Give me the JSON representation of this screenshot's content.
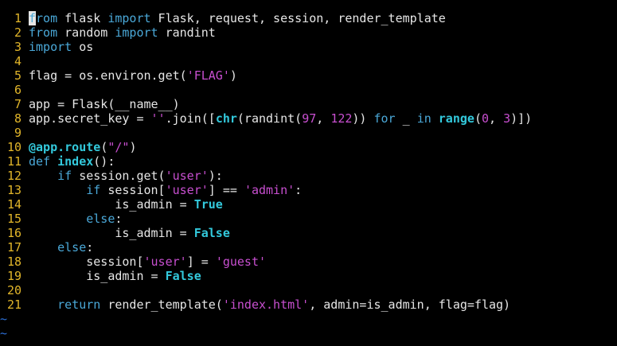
{
  "colors": {
    "background": "#000000",
    "text": "#e6e6e6",
    "line_number": "#e2b62a",
    "keyword": "#4aa8d8",
    "string": "#c84fd0",
    "builtin": "#33c9dc",
    "tilde": "#2c6fd6"
  },
  "editor": {
    "cursor_line": 1,
    "lines": [
      {
        "num": "1",
        "tokens": [
          {
            "t": "f",
            "k": "cursor"
          },
          {
            "t": "rom",
            "k": "keyword"
          },
          {
            "t": " flask ",
            "k": "plain"
          },
          {
            "t": "import",
            "k": "keyword"
          },
          {
            "t": " Flask, request, session, render_template",
            "k": "plain"
          }
        ]
      },
      {
        "num": "2",
        "tokens": [
          {
            "t": "from",
            "k": "keyword"
          },
          {
            "t": " random ",
            "k": "plain"
          },
          {
            "t": "import",
            "k": "keyword"
          },
          {
            "t": " randint",
            "k": "plain"
          }
        ]
      },
      {
        "num": "3",
        "tokens": [
          {
            "t": "import",
            "k": "keyword"
          },
          {
            "t": " os",
            "k": "plain"
          }
        ]
      },
      {
        "num": "4",
        "tokens": []
      },
      {
        "num": "5",
        "tokens": [
          {
            "t": "flag = os.environ.get(",
            "k": "plain"
          },
          {
            "t": "'FLAG'",
            "k": "string"
          },
          {
            "t": ")",
            "k": "plain"
          }
        ]
      },
      {
        "num": "6",
        "tokens": []
      },
      {
        "num": "7",
        "tokens": [
          {
            "t": "app = Flask(__name__)",
            "k": "plain"
          }
        ]
      },
      {
        "num": "8",
        "tokens": [
          {
            "t": "app.secret_key = ",
            "k": "plain"
          },
          {
            "t": "''",
            "k": "string"
          },
          {
            "t": ".join([",
            "k": "plain"
          },
          {
            "t": "chr",
            "k": "builtin"
          },
          {
            "t": "(randint(",
            "k": "plain"
          },
          {
            "t": "97",
            "k": "number"
          },
          {
            "t": ", ",
            "k": "plain"
          },
          {
            "t": "122",
            "k": "number"
          },
          {
            "t": ")) ",
            "k": "plain"
          },
          {
            "t": "for",
            "k": "keyword"
          },
          {
            "t": " _ ",
            "k": "plain"
          },
          {
            "t": "in",
            "k": "keyword"
          },
          {
            "t": " ",
            "k": "plain"
          },
          {
            "t": "range",
            "k": "builtin"
          },
          {
            "t": "(",
            "k": "plain"
          },
          {
            "t": "0",
            "k": "number"
          },
          {
            "t": ", ",
            "k": "plain"
          },
          {
            "t": "3",
            "k": "number"
          },
          {
            "t": ")])",
            "k": "plain"
          }
        ]
      },
      {
        "num": "9",
        "tokens": []
      },
      {
        "num": "10",
        "tokens": [
          {
            "t": "@app.route",
            "k": "decorator"
          },
          {
            "t": "(",
            "k": "plain"
          },
          {
            "t": "\"/\"",
            "k": "string"
          },
          {
            "t": ")",
            "k": "plain"
          }
        ]
      },
      {
        "num": "11",
        "tokens": [
          {
            "t": "def",
            "k": "keyword"
          },
          {
            "t": " ",
            "k": "plain"
          },
          {
            "t": "index",
            "k": "funcname"
          },
          {
            "t": "():",
            "k": "plain"
          }
        ]
      },
      {
        "num": "12",
        "tokens": [
          {
            "t": "    ",
            "k": "plain"
          },
          {
            "t": "if",
            "k": "keyword"
          },
          {
            "t": " session.get(",
            "k": "plain"
          },
          {
            "t": "'user'",
            "k": "string"
          },
          {
            "t": "):",
            "k": "plain"
          }
        ]
      },
      {
        "num": "13",
        "tokens": [
          {
            "t": "        ",
            "k": "plain"
          },
          {
            "t": "if",
            "k": "keyword"
          },
          {
            "t": " session[",
            "k": "plain"
          },
          {
            "t": "'user'",
            "k": "string"
          },
          {
            "t": "] == ",
            "k": "plain"
          },
          {
            "t": "'admin'",
            "k": "string"
          },
          {
            "t": ":",
            "k": "plain"
          }
        ]
      },
      {
        "num": "14",
        "tokens": [
          {
            "t": "            is_admin = ",
            "k": "plain"
          },
          {
            "t": "True",
            "k": "const"
          }
        ]
      },
      {
        "num": "15",
        "tokens": [
          {
            "t": "        ",
            "k": "plain"
          },
          {
            "t": "else",
            "k": "keyword"
          },
          {
            "t": ":",
            "k": "plain"
          }
        ]
      },
      {
        "num": "16",
        "tokens": [
          {
            "t": "            is_admin = ",
            "k": "plain"
          },
          {
            "t": "False",
            "k": "const"
          }
        ]
      },
      {
        "num": "17",
        "tokens": [
          {
            "t": "    ",
            "k": "plain"
          },
          {
            "t": "else",
            "k": "keyword"
          },
          {
            "t": ":",
            "k": "plain"
          }
        ]
      },
      {
        "num": "18",
        "tokens": [
          {
            "t": "        session[",
            "k": "plain"
          },
          {
            "t": "'user'",
            "k": "string"
          },
          {
            "t": "] = ",
            "k": "plain"
          },
          {
            "t": "'guest'",
            "k": "string"
          }
        ]
      },
      {
        "num": "19",
        "tokens": [
          {
            "t": "        is_admin = ",
            "k": "plain"
          },
          {
            "t": "False",
            "k": "const"
          }
        ]
      },
      {
        "num": "20",
        "tokens": []
      },
      {
        "num": "21",
        "tokens": [
          {
            "t": "    ",
            "k": "plain"
          },
          {
            "t": "return",
            "k": "keyword"
          },
          {
            "t": " render_template(",
            "k": "plain"
          },
          {
            "t": "'index.html'",
            "k": "string"
          },
          {
            "t": ", admin=is_admin, flag=flag)",
            "k": "plain"
          }
        ]
      }
    ],
    "empty_markers": [
      "~",
      "~"
    ]
  }
}
